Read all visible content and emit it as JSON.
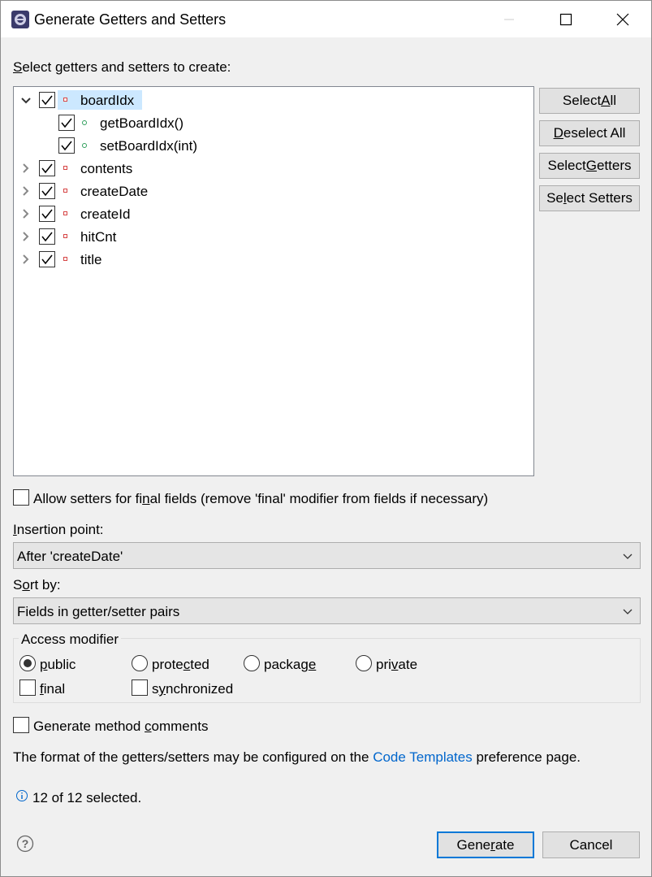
{
  "window": {
    "title": "Generate Getters and Setters"
  },
  "select_label_pre": "",
  "select_label_u": "S",
  "select_label_post": "elect getters and setters to create:",
  "tree": [
    {
      "label": "boardIdx",
      "kind": "field",
      "expanded": true,
      "checked": true,
      "children": [
        {
          "label": "getBoardIdx()",
          "kind": "method",
          "checked": true
        },
        {
          "label": "setBoardIdx(int)",
          "kind": "method",
          "checked": true
        }
      ]
    },
    {
      "label": "contents",
      "kind": "field",
      "expanded": false,
      "checked": true
    },
    {
      "label": "createDate",
      "kind": "field",
      "expanded": false,
      "checked": true
    },
    {
      "label": "createId",
      "kind": "field",
      "expanded": false,
      "checked": true
    },
    {
      "label": "hitCnt",
      "kind": "field",
      "expanded": false,
      "checked": true
    },
    {
      "label": "title",
      "kind": "field",
      "expanded": false,
      "checked": true
    }
  ],
  "buttons": {
    "select_all": {
      "pre": "Select ",
      "u": "A",
      "post": "ll"
    },
    "deselect_all": {
      "pre": "",
      "u": "D",
      "post": "eselect All"
    },
    "select_getters": {
      "pre": "Select ",
      "u": "G",
      "post": "etters"
    },
    "select_setters": {
      "pre": "Se",
      "u": "l",
      "post": "ect Setters"
    },
    "generate": {
      "pre": "Gene",
      "u": "r",
      "post": "ate"
    },
    "cancel": "Cancel"
  },
  "allow_final": {
    "pre": "Allow setters for fi",
    "u": "n",
    "post": "al fields (remove 'final' modifier from fields if necessary)",
    "checked": false
  },
  "insertion": {
    "label_u": "I",
    "label_post": "nsertion point:",
    "value": "After 'createDate'"
  },
  "sort": {
    "label_pre": "S",
    "label_u": "o",
    "label_post": "rt by:",
    "value": "Fields in getter/setter pairs"
  },
  "access": {
    "title": "Access modifier",
    "public": {
      "u": "p",
      "post": "ublic",
      "selected": true
    },
    "protected": {
      "pre": "prote",
      "u": "c",
      "post": "ted",
      "selected": false
    },
    "package": {
      "pre": "packag",
      "u": "e",
      "post": "",
      "selected": false
    },
    "private": {
      "pre": "pri",
      "u": "v",
      "post": "ate",
      "selected": false
    },
    "final": {
      "u": "f",
      "post": "inal",
      "checked": false
    },
    "synchronized": {
      "pre": "s",
      "u": "y",
      "post": "nchronized",
      "checked": false
    }
  },
  "comments": {
    "pre": "Generate method ",
    "u": "c",
    "post": "omments",
    "checked": false
  },
  "format_note": {
    "pre": "The format of the getters/setters may be configured on the ",
    "link": "Code Templates",
    "post": " preference page."
  },
  "status": "12 of 12 selected.",
  "colors": {
    "accent": "#0078d7",
    "link": "#0066cc",
    "selection": "#cce8ff"
  }
}
